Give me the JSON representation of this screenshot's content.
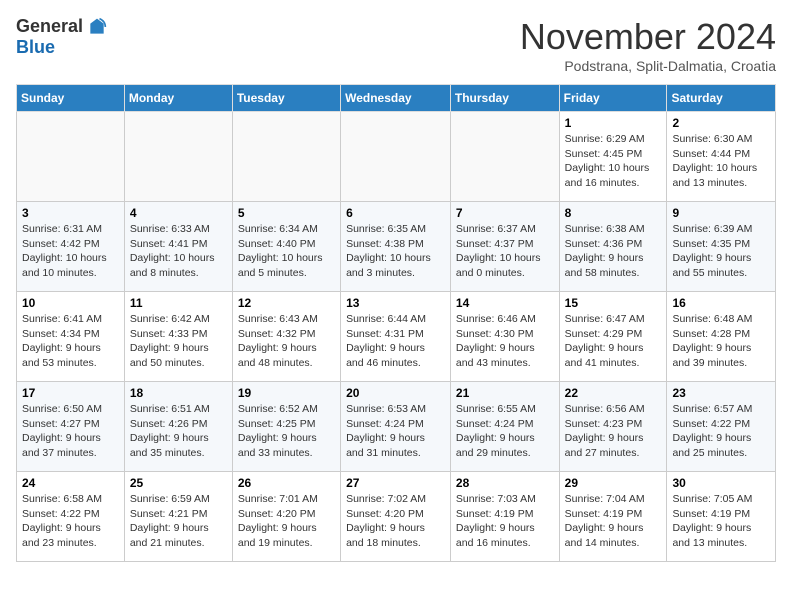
{
  "logo": {
    "general": "General",
    "blue": "Blue"
  },
  "title": "November 2024",
  "subtitle": "Podstrana, Split-Dalmatia, Croatia",
  "headers": [
    "Sunday",
    "Monday",
    "Tuesday",
    "Wednesday",
    "Thursday",
    "Friday",
    "Saturday"
  ],
  "weeks": [
    [
      {
        "day": "",
        "info": ""
      },
      {
        "day": "",
        "info": ""
      },
      {
        "day": "",
        "info": ""
      },
      {
        "day": "",
        "info": ""
      },
      {
        "day": "",
        "info": ""
      },
      {
        "day": "1",
        "info": "Sunrise: 6:29 AM\nSunset: 4:45 PM\nDaylight: 10 hours and 16 minutes."
      },
      {
        "day": "2",
        "info": "Sunrise: 6:30 AM\nSunset: 4:44 PM\nDaylight: 10 hours and 13 minutes."
      }
    ],
    [
      {
        "day": "3",
        "info": "Sunrise: 6:31 AM\nSunset: 4:42 PM\nDaylight: 10 hours and 10 minutes."
      },
      {
        "day": "4",
        "info": "Sunrise: 6:33 AM\nSunset: 4:41 PM\nDaylight: 10 hours and 8 minutes."
      },
      {
        "day": "5",
        "info": "Sunrise: 6:34 AM\nSunset: 4:40 PM\nDaylight: 10 hours and 5 minutes."
      },
      {
        "day": "6",
        "info": "Sunrise: 6:35 AM\nSunset: 4:38 PM\nDaylight: 10 hours and 3 minutes."
      },
      {
        "day": "7",
        "info": "Sunrise: 6:37 AM\nSunset: 4:37 PM\nDaylight: 10 hours and 0 minutes."
      },
      {
        "day": "8",
        "info": "Sunrise: 6:38 AM\nSunset: 4:36 PM\nDaylight: 9 hours and 58 minutes."
      },
      {
        "day": "9",
        "info": "Sunrise: 6:39 AM\nSunset: 4:35 PM\nDaylight: 9 hours and 55 minutes."
      }
    ],
    [
      {
        "day": "10",
        "info": "Sunrise: 6:41 AM\nSunset: 4:34 PM\nDaylight: 9 hours and 53 minutes."
      },
      {
        "day": "11",
        "info": "Sunrise: 6:42 AM\nSunset: 4:33 PM\nDaylight: 9 hours and 50 minutes."
      },
      {
        "day": "12",
        "info": "Sunrise: 6:43 AM\nSunset: 4:32 PM\nDaylight: 9 hours and 48 minutes."
      },
      {
        "day": "13",
        "info": "Sunrise: 6:44 AM\nSunset: 4:31 PM\nDaylight: 9 hours and 46 minutes."
      },
      {
        "day": "14",
        "info": "Sunrise: 6:46 AM\nSunset: 4:30 PM\nDaylight: 9 hours and 43 minutes."
      },
      {
        "day": "15",
        "info": "Sunrise: 6:47 AM\nSunset: 4:29 PM\nDaylight: 9 hours and 41 minutes."
      },
      {
        "day": "16",
        "info": "Sunrise: 6:48 AM\nSunset: 4:28 PM\nDaylight: 9 hours and 39 minutes."
      }
    ],
    [
      {
        "day": "17",
        "info": "Sunrise: 6:50 AM\nSunset: 4:27 PM\nDaylight: 9 hours and 37 minutes."
      },
      {
        "day": "18",
        "info": "Sunrise: 6:51 AM\nSunset: 4:26 PM\nDaylight: 9 hours and 35 minutes."
      },
      {
        "day": "19",
        "info": "Sunrise: 6:52 AM\nSunset: 4:25 PM\nDaylight: 9 hours and 33 minutes."
      },
      {
        "day": "20",
        "info": "Sunrise: 6:53 AM\nSunset: 4:24 PM\nDaylight: 9 hours and 31 minutes."
      },
      {
        "day": "21",
        "info": "Sunrise: 6:55 AM\nSunset: 4:24 PM\nDaylight: 9 hours and 29 minutes."
      },
      {
        "day": "22",
        "info": "Sunrise: 6:56 AM\nSunset: 4:23 PM\nDaylight: 9 hours and 27 minutes."
      },
      {
        "day": "23",
        "info": "Sunrise: 6:57 AM\nSunset: 4:22 PM\nDaylight: 9 hours and 25 minutes."
      }
    ],
    [
      {
        "day": "24",
        "info": "Sunrise: 6:58 AM\nSunset: 4:22 PM\nDaylight: 9 hours and 23 minutes."
      },
      {
        "day": "25",
        "info": "Sunrise: 6:59 AM\nSunset: 4:21 PM\nDaylight: 9 hours and 21 minutes."
      },
      {
        "day": "26",
        "info": "Sunrise: 7:01 AM\nSunset: 4:20 PM\nDaylight: 9 hours and 19 minutes."
      },
      {
        "day": "27",
        "info": "Sunrise: 7:02 AM\nSunset: 4:20 PM\nDaylight: 9 hours and 18 minutes."
      },
      {
        "day": "28",
        "info": "Sunrise: 7:03 AM\nSunset: 4:19 PM\nDaylight: 9 hours and 16 minutes."
      },
      {
        "day": "29",
        "info": "Sunrise: 7:04 AM\nSunset: 4:19 PM\nDaylight: 9 hours and 14 minutes."
      },
      {
        "day": "30",
        "info": "Sunrise: 7:05 AM\nSunset: 4:19 PM\nDaylight: 9 hours and 13 minutes."
      }
    ]
  ]
}
